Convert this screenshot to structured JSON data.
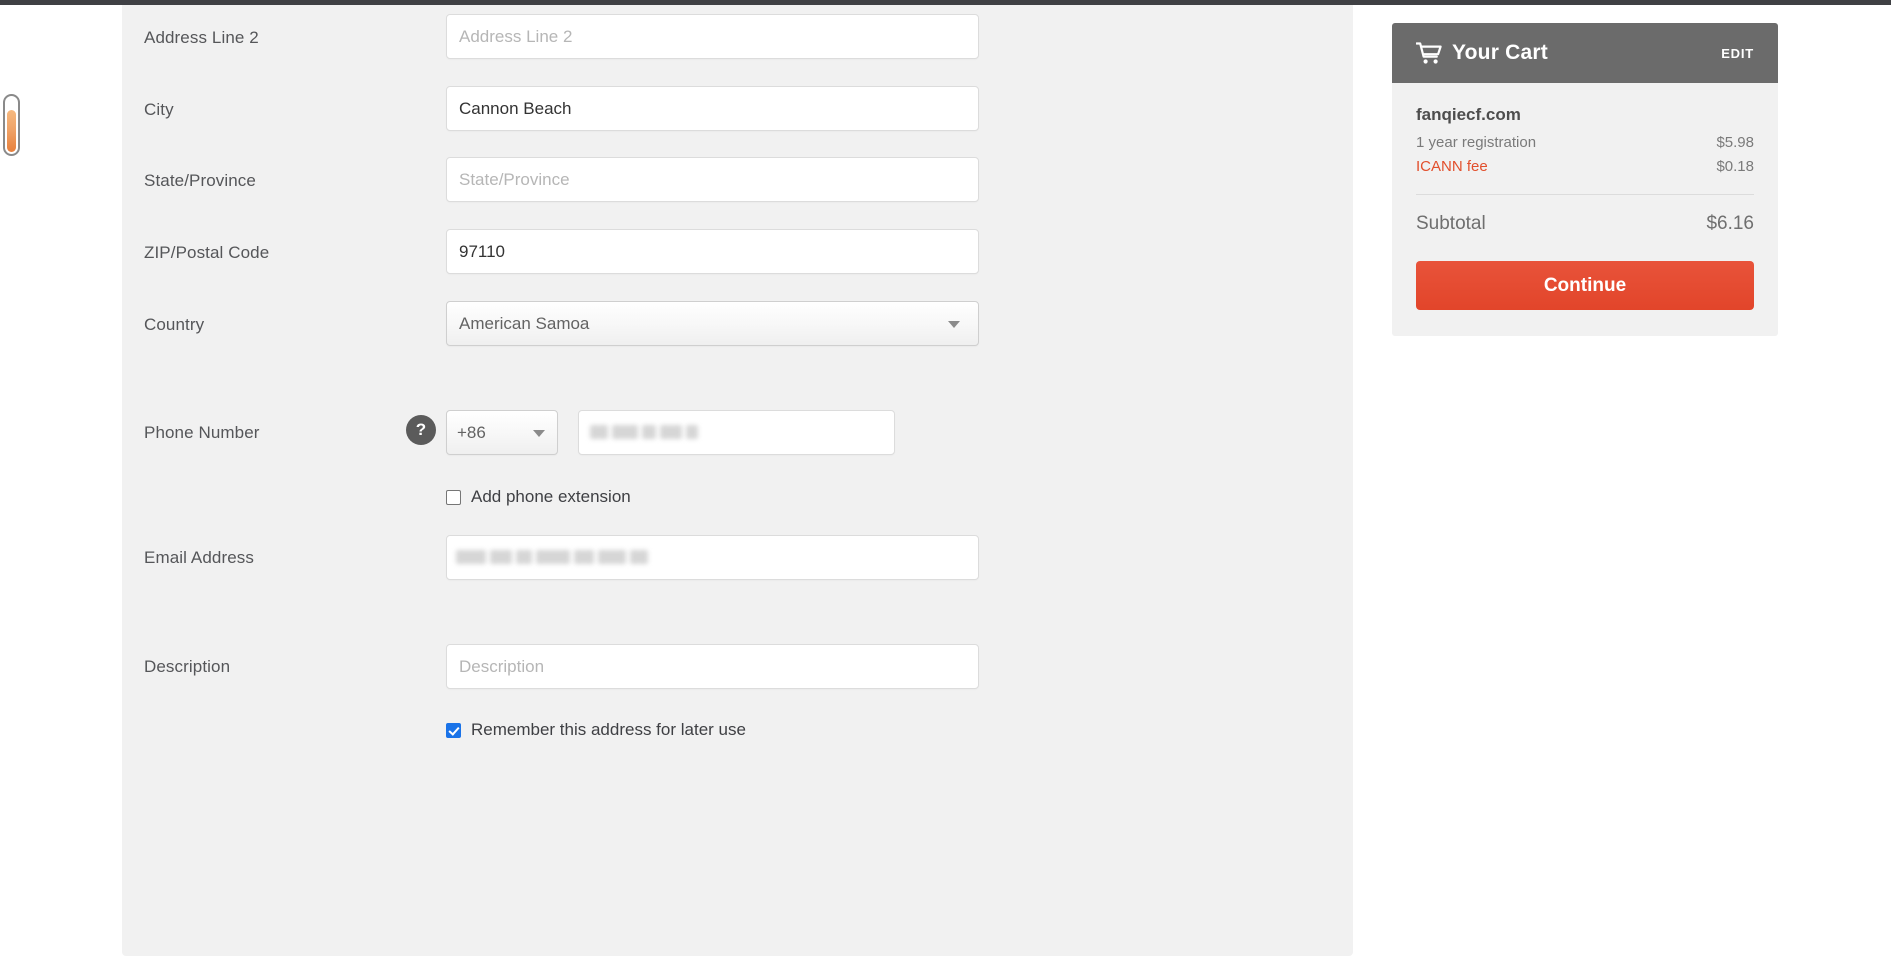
{
  "form": {
    "fields": [
      {
        "id": "address-line-2",
        "label": "Address Line 2",
        "placeholder": "Address Line 2",
        "value": ""
      },
      {
        "id": "city",
        "label": "City",
        "placeholder": "City",
        "value": "Cannon Beach"
      },
      {
        "id": "state-province",
        "label": "State/Province",
        "placeholder": "State/Province",
        "value": ""
      },
      {
        "id": "zip-postal-code",
        "label": "ZIP/Postal Code",
        "placeholder": "ZIP/Postal Code",
        "value": "97110"
      },
      {
        "id": "country",
        "label": "Country",
        "value": "American Samoa"
      }
    ],
    "phone": {
      "label": "Phone Number",
      "help_icon": "question-mark-icon",
      "country_code": "+86",
      "number_value": "",
      "number_redacted": true,
      "extension_checkbox": {
        "label": "Add phone extension",
        "checked": false
      }
    },
    "email": {
      "label": "Email Address",
      "placeholder": "Email Address",
      "value": "",
      "redacted": true
    },
    "description": {
      "label": "Description",
      "placeholder": "Description",
      "value": ""
    },
    "remember_checkbox": {
      "label": "Remember this address for later use",
      "checked": true
    }
  },
  "cart": {
    "icon": "shopping-cart-icon",
    "title": "Your Cart",
    "edit_label": "EDIT",
    "domain": "fanqiecf.com",
    "lines": [
      {
        "label": "1 year registration",
        "price": "$5.98",
        "accent": false
      },
      {
        "label": "ICANN fee",
        "price": "$0.18",
        "accent": true
      }
    ],
    "subtotal_label": "Subtotal",
    "subtotal_value": "$6.16",
    "continue_label": "Continue"
  },
  "colors": {
    "accent_red": "#e24f2c",
    "cart_header_gray": "#6b6b6b",
    "panel_gray": "#f1f1f1",
    "checkbox_blue": "#1a73e8"
  }
}
